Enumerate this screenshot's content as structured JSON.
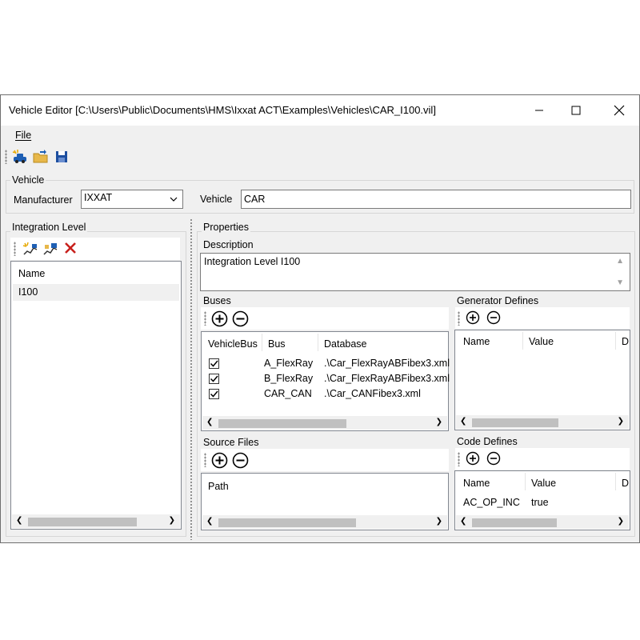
{
  "window": {
    "title": "Vehicle Editor [C:\\Users\\Public\\Documents\\HMS\\Ixxat ACT\\Examples\\Vehicles\\CAR_I100.vil]"
  },
  "menu": {
    "file": "File"
  },
  "vehicle": {
    "group_label": "Vehicle",
    "manufacturer_label": "Manufacturer",
    "manufacturer_value": "IXXAT",
    "vehicle_label": "Vehicle",
    "vehicle_value": "CAR"
  },
  "integration": {
    "group_label": "Integration Level",
    "column_name": "Name",
    "rows": [
      "I100"
    ]
  },
  "properties": {
    "group_label": "Properties",
    "description_label": "Description",
    "description_value": "Integration Level I100"
  },
  "buses": {
    "label": "Buses",
    "columns": [
      "VehicleBus",
      "Bus",
      "Database"
    ],
    "rows": [
      {
        "checked": true,
        "bus": "A_FlexRay",
        "database": ".\\Car_FlexRayABFibex3.xml"
      },
      {
        "checked": true,
        "bus": "B_FlexRay",
        "database": ".\\Car_FlexRayABFibex3.xml"
      },
      {
        "checked": true,
        "bus": "CAR_CAN",
        "database": ".\\Car_CANFibex3.xml"
      }
    ]
  },
  "generator_defines": {
    "label": "Generator Defines",
    "columns": [
      "Name",
      "Value",
      "D"
    ]
  },
  "source_files": {
    "label": "Source Files",
    "columns": [
      "Path"
    ]
  },
  "code_defines": {
    "label": "Code Defines",
    "columns": [
      "Name",
      "Value",
      "D"
    ],
    "rows": [
      {
        "name": "AC_OP_INC",
        "value": "true"
      }
    ]
  }
}
